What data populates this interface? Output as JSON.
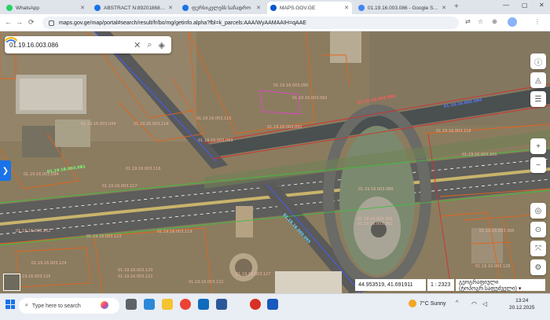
{
  "browser": {
    "tabs": [
      {
        "title": "WhatsApp",
        "favicon_color": "#25d366",
        "active": false
      },
      {
        "title": "ABSTRACT N:892018688021",
        "favicon_color": "#1a73e8",
        "active": false
      },
      {
        "title": "ფურსიკელებს საჩადრო",
        "favicon_color": "#1a73e8",
        "active": false
      },
      {
        "title": "MAPS.GOV.GE",
        "favicon_color": "#0b57d0",
        "active": true
      },
      {
        "title": "01.19.16.003.086 - Google Search",
        "favicon_color": "#4285f4",
        "active": false
      }
    ],
    "new_tab_label": "+",
    "window_controls": {
      "minimize": "—",
      "maximize": "▢",
      "close": "✕"
    },
    "url": "maps.gov.ge/map/portal#search/result/fr/bo/mg/getinfo.alpha?fbl=k_parcels:AAA/WyAAMAAIH=qAAE",
    "nav": {
      "back": "←",
      "forward": "→",
      "reload": "⟳",
      "site_info": "⚙"
    },
    "toolbar_icons": [
      "☆",
      "⊕",
      "⋮"
    ]
  },
  "map": {
    "search": {
      "query": "01.19.16.003.086",
      "clear_icon": "✕",
      "search_icon": "⌕",
      "layers_icon": "◈"
    },
    "parcel_labels": [
      "01.19.16.003.044",
      "01.19.16.003.114",
      "01.19.16.003.115",
      "01.19.16.003.090",
      "01.19.16.003.091",
      "01.19.16.003.092",
      "01.19.16.003.093",
      "01.19.16.003.094",
      "01.19.16.003.116",
      "01.19.16.003.117",
      "01.19.16.003.118",
      "01.19.16.003.201",
      "01.19.16.003.202",
      "01.19.16.003.123",
      "01.19.16.003.119",
      "01.19.16.003.124",
      "01.19.16.003.390",
      "01.19.16.003.391",
      "01.19.16.003.120",
      "01.19.16.003.121",
      "01.19.16.003.122",
      "01.19.16.003.395",
      "01.19.16.003.126",
      "01.19.16.003.125",
      "01.19.16.003.127",
      "01.19.16.003.086"
    ],
    "road_labels": [
      "01.19.16.003.086",
      "01.19.16.003.084",
      "01.19.16.003.081",
      "01.19.16.003.095"
    ],
    "right_tools": [
      "ⓘ",
      "◬",
      "☰",
      "+",
      "−",
      "◎",
      "⊙",
      "⤧",
      "⚙"
    ],
    "left_panel_toggle": "❯",
    "coordinates": "44.953519, 41.691911",
    "scale": "1 : 2323",
    "basemap_selector": "გეოგრაფიული (ტოპოგრ.საფუძველი) ▾"
  },
  "taskbar": {
    "search_placeholder": "Type here to search",
    "search_icon": "⌕",
    "weather": "7°C  Sunny",
    "time": "13:24",
    "date": "20.12.2025",
    "apps": [
      {
        "name": "task-view",
        "color": "#5f6368"
      },
      {
        "name": "edge",
        "color": "#2b88d8"
      },
      {
        "name": "file-explorer",
        "color": "#f4c430"
      },
      {
        "name": "chrome",
        "color": "#ea4335"
      },
      {
        "name": "mail",
        "color": "#0f6cbd"
      },
      {
        "name": "word",
        "color": "#2b579a"
      },
      {
        "name": "screen-recorder",
        "color": "#d93025"
      },
      {
        "name": "word-2",
        "color": "#185abd"
      }
    ]
  }
}
